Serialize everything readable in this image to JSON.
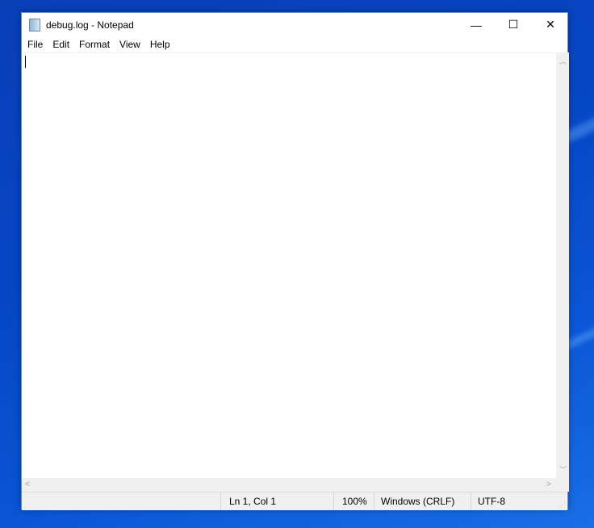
{
  "window": {
    "title": "debug.log - Notepad",
    "minimize": "—",
    "maximize": "☐",
    "close": "✕"
  },
  "menu": [
    "File",
    "Edit",
    "Format",
    "View",
    "Help"
  ],
  "editor": {
    "content": ""
  },
  "status": {
    "position": "Ln 1, Col 1",
    "zoom": "100%",
    "line_ending": "Windows (CRLF)",
    "encoding": "UTF-8"
  }
}
